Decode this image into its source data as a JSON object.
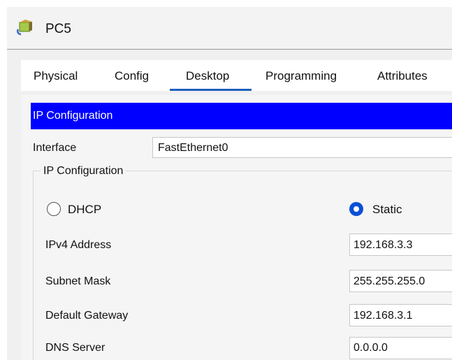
{
  "window": {
    "title": "PC5",
    "icon": "pc-device-icon"
  },
  "tabs": [
    {
      "label": "Physical",
      "active": false
    },
    {
      "label": "Config",
      "active": false
    },
    {
      "label": "Desktop",
      "active": true
    },
    {
      "label": "Programming",
      "active": false
    },
    {
      "label": "Attributes",
      "active": false
    }
  ],
  "section": {
    "title": "IP Configuration",
    "color": "#0000ff"
  },
  "interface": {
    "label": "Interface",
    "value": "FastEthernet0"
  },
  "ip_group": {
    "legend": "IP Configuration",
    "dhcp_label": "DHCP",
    "static_label": "Static",
    "mode": "Static"
  },
  "fields": {
    "ipv4": {
      "label": "IPv4 Address",
      "value": "192.168.3.3"
    },
    "subnet": {
      "label": "Subnet Mask",
      "value": "255.255.255.0"
    },
    "gateway": {
      "label": "Default Gateway",
      "value": "192.168.3.1"
    },
    "dns": {
      "label": "DNS Server",
      "value": "0.0.0.0"
    }
  },
  "colors": {
    "radio_selected": "#0a4fd6",
    "active_tab_underline": "#1f5fbf"
  }
}
